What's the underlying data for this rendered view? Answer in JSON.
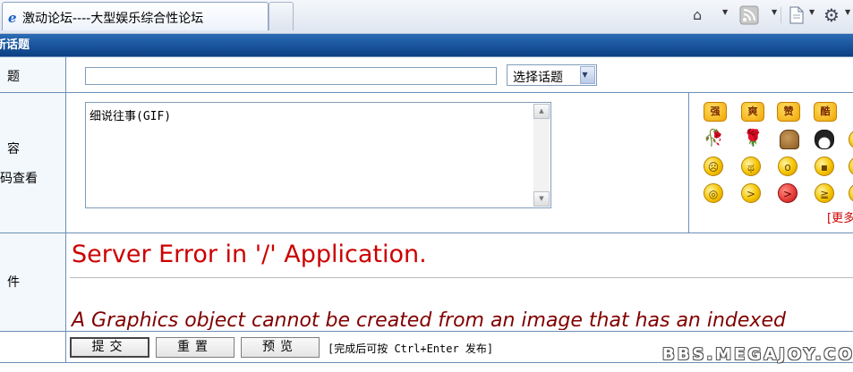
{
  "browser": {
    "tab_title": "激动论坛----大型娱乐综合性论坛",
    "icons": [
      "ie-logo-icon",
      "home-icon",
      "rss-feed-icon",
      "page-menu-icon",
      "tools-gear-icon"
    ]
  },
  "form": {
    "header_title": "新话题",
    "labels": {
      "subject": "题",
      "content": "容",
      "content_hint": "码查看",
      "attachment": "件"
    },
    "subject": {
      "value": ""
    },
    "topic_select": {
      "selected": "选择话题"
    },
    "content": {
      "value": "细说往事(GIF)"
    },
    "emoticons": {
      "text_badges": [
        "强",
        "爽",
        "赞",
        "酷"
      ],
      "more_link": "更多"
    },
    "error": {
      "title": "Server Error in '/' Application.",
      "message": "A Graphics object cannot be created from an image that has an indexed"
    },
    "buttons": {
      "submit": "提交",
      "reset": "重置",
      "preview": "预览"
    },
    "hint": "[完成后可按 Ctrl+Enter 发布]"
  },
  "watermark": "BBS.MEGAJOY.COM",
  "colors": {
    "header_bg": "#0c3f83",
    "error_title": "#cc0000",
    "error_message": "#800000",
    "more_link": "#cc0000"
  }
}
